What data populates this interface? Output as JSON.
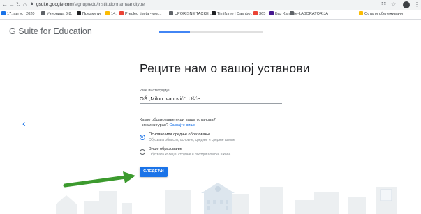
{
  "browser": {
    "url_host": "gsuite.google.com",
    "url_path": "/signup/edu/institutionnameandtype",
    "bookmarks": [
      {
        "label": "17. август 2020",
        "color": "#1a73e8"
      },
      {
        "label": "Учионица 3.8.",
        "color": "#5f6368"
      },
      {
        "label": "Предмети",
        "color": "#202124"
      },
      {
        "label": "14.",
        "color": "#fbbc04"
      },
      {
        "label": "Pregled tiketa - wor...",
        "color": "#ea4335"
      },
      {
        "label": "UPORISNE TACKE...",
        "color": "#5f6368"
      },
      {
        "label": "Timify.me | Dashbo...",
        "color": "#202124"
      },
      {
        "label": "365",
        "color": "#ea4335"
      },
      {
        "label": "Баз Kahoot",
        "color": "#46178f"
      },
      {
        "label": "e-LABORATORIJA",
        "color": "#5f6368"
      },
      {
        "label": "Остали обележивачи",
        "color": "#fbbc04"
      }
    ]
  },
  "header": {
    "logo": "G Suite for Education",
    "progress": 0.3
  },
  "main": {
    "title": "Реците нам о вашој установи",
    "institution_label": "Име институције",
    "institution_value": "OŠ „Milun Ivanović\", Ušće",
    "question": "Какво образовање нуди ваша установа?",
    "not_sure": "Нисам сигуран?",
    "not_sure_link": "Сазнајте више",
    "options": [
      {
        "title": "Основно или средње образовање",
        "subtitle": "Обухвата области, основне, средње и средње школе",
        "selected": true
      },
      {
        "title": "Више образовање",
        "subtitle": "Обухвата колеџе, стручне и постдипломске школе",
        "selected": false
      }
    ],
    "next_label": "СЛЕДЕЋИ"
  },
  "colors": {
    "accent": "#1a73e8",
    "arrow": "#3c9a2e"
  },
  "icons": [
    "back-arrow-icon",
    "lock-icon",
    "star-icon",
    "menu-dots-icon"
  ]
}
